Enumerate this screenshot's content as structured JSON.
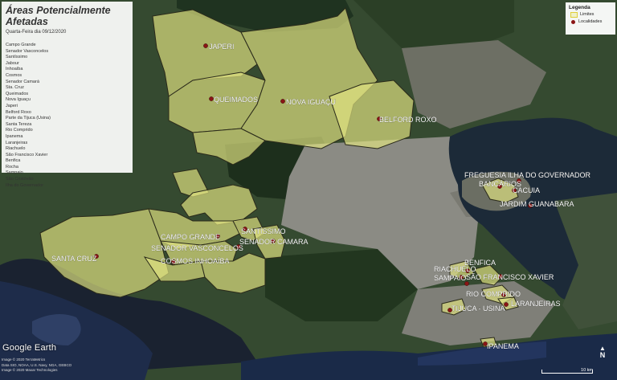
{
  "panel": {
    "title": "Áreas Potencialmente Afetadas",
    "subtitle": "Quarta-Feira dia 09/12/2020",
    "areas": [
      "Campo Grande",
      "Senador Vasconcelos",
      "Santíssimo",
      "Jabour",
      "Inhoaíba",
      "Cosmos",
      "Senador Camará",
      "Sta. Cruz",
      "Queimados",
      "Nova Iguaçu",
      "Japeri",
      "Belford Roxo",
      "Parte da Tijuca (Usina)",
      "Santa Tereza",
      "Rio Comprido",
      "Ipanema",
      "Laranjeiras",
      "Riachuelo",
      "São Francisco Xavier",
      "Benfica",
      "Rocha",
      "Sampaio",
      "São Cristóvão",
      "Ilha do Governador"
    ]
  },
  "legend": {
    "title": "Legenda",
    "limits_label": "Limites",
    "localities_label": "Localidades",
    "colors": {
      "limits": "#e0cf3a",
      "localities": "#8a1515"
    }
  },
  "places": [
    {
      "name": "JAPERI"
    },
    {
      "name": "QUEIMADOS"
    },
    {
      "name": "NOVA IGUAÇU"
    },
    {
      "name": "BELFORD ROXO"
    },
    {
      "name": "SANTA CRUZ"
    },
    {
      "name": "CAMPO GRANDE"
    },
    {
      "name": "SANTÍSSIMO"
    },
    {
      "name": "SENADOR CAMARA"
    },
    {
      "name": "SENADOR VASCONCELOS"
    },
    {
      "name": "COSMOS INHOAÍBA"
    },
    {
      "name": "FREGUESIA ILHA DO GOVERNADOR"
    },
    {
      "name": "BANCÁRIOS"
    },
    {
      "name": "CACUIA"
    },
    {
      "name": "JARDIM GUANABARA"
    },
    {
      "name": "BENFICA"
    },
    {
      "name": "RIACHUELO"
    },
    {
      "name": "SAMPAIO"
    },
    {
      "name": "SÃO FRANCISCO XAVIER"
    },
    {
      "name": "RIO COMPRIDO"
    },
    {
      "name": "TIJUCA - USINA"
    },
    {
      "name": "LARANJEIRAS"
    },
    {
      "name": "IPANEMA"
    }
  ],
  "branding": {
    "logo": "Google Earth",
    "credits": [
      "Image © 2020 TerraMetrics",
      "Data SIO, NOAA, U.S. Navy, NGA, GEBCO",
      "Image © 2020 Maxar Technologies"
    ]
  },
  "north_label": "N",
  "scale_label": "10 km"
}
